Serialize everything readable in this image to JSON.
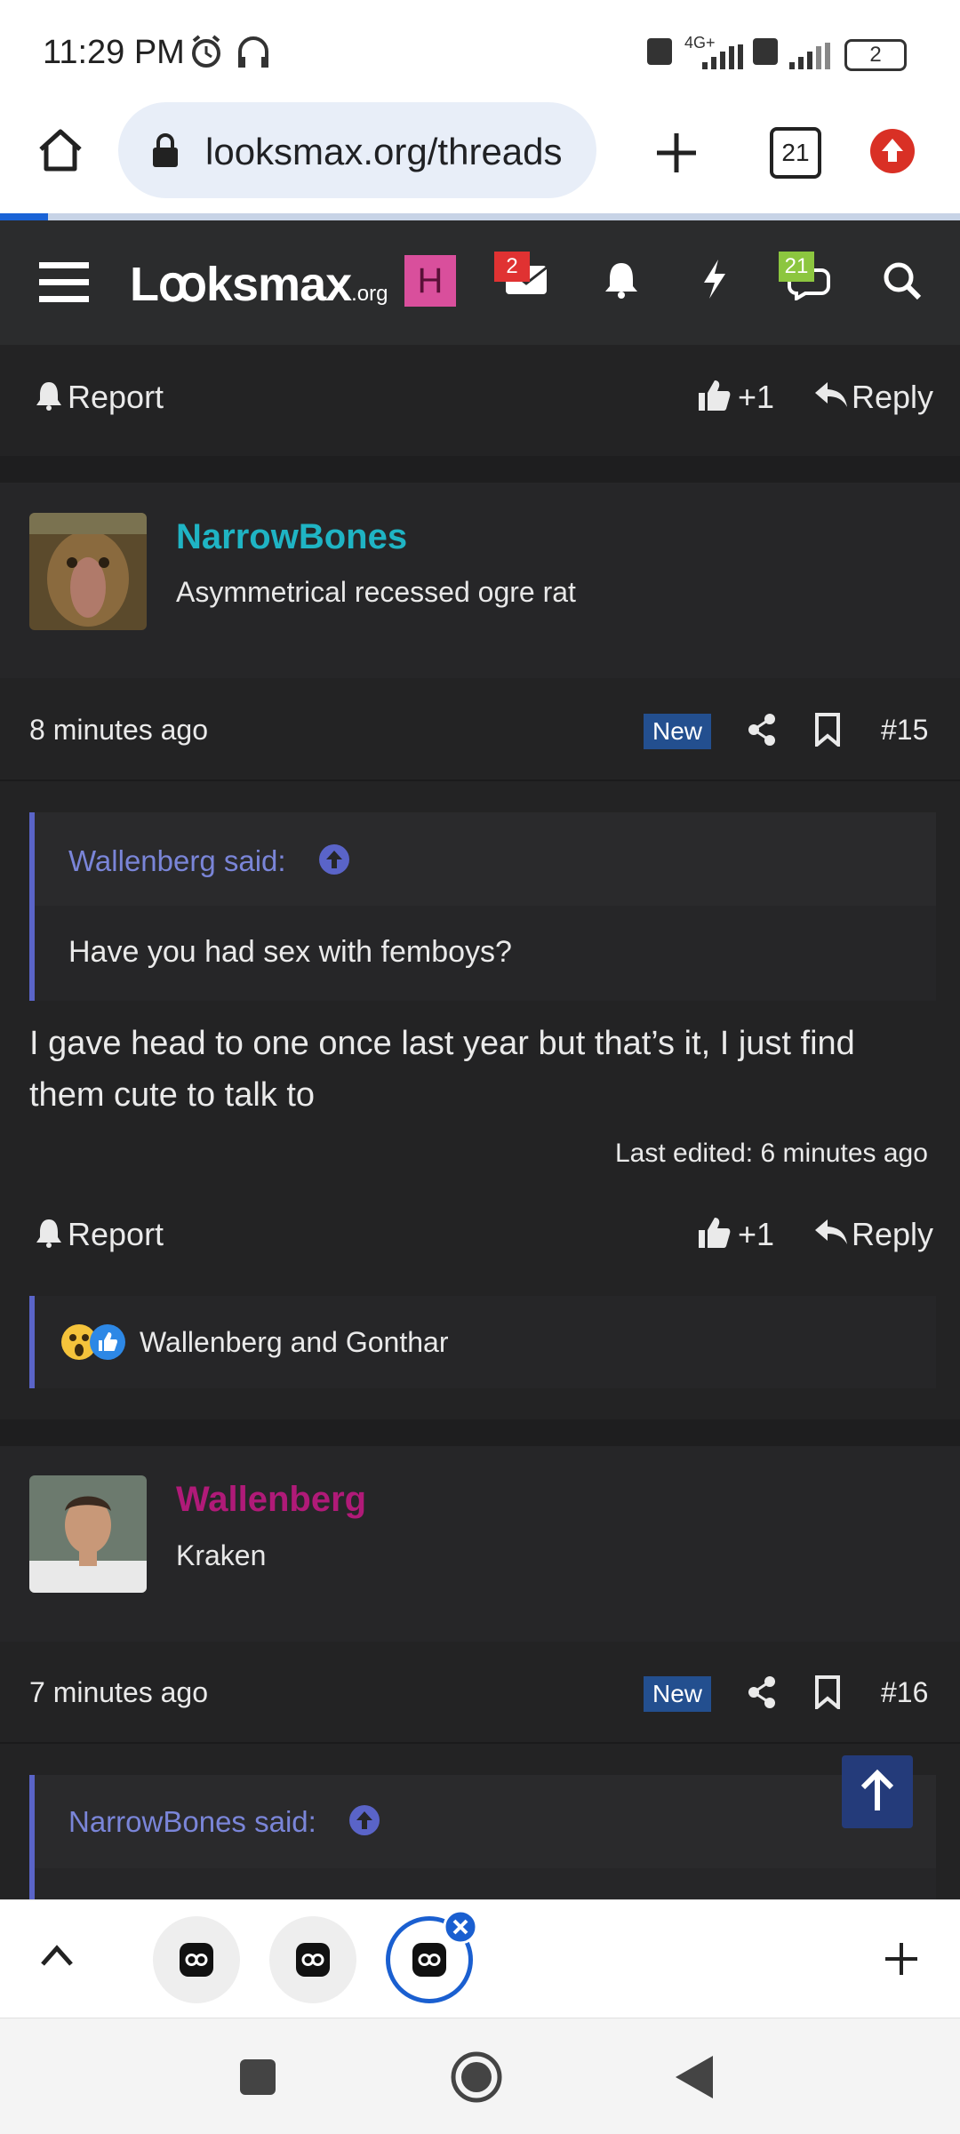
{
  "status_bar": {
    "time": "11:29 PM",
    "network": "4G+",
    "battery": "2"
  },
  "browser": {
    "url": "looksmax.org/threads",
    "tab_count": "21"
  },
  "forum_header": {
    "logo_main": "Lꝏksmax",
    "logo_suffix": ".org",
    "user_initial": "H",
    "inbox_count": "2",
    "conversations_count": "21"
  },
  "actions": {
    "report": "Report",
    "like": "+1",
    "reply": "Reply"
  },
  "posts": [
    {
      "username": "NarrowBones",
      "user_title": "Asymmetrical recessed ogre rat",
      "time": "8 minutes ago",
      "new_label": "New",
      "number": "#15",
      "quote_author": "Wallenberg said:",
      "quote_text": "Have you had sex with femboys?",
      "body_line1": "I gave head to one once last year but that’s it, I just find",
      "body_line2": "them cute to talk to",
      "edited": "Last edited: 6 minutes ago",
      "reactions": "Wallenberg and Gonthar"
    },
    {
      "username": "Wallenberg",
      "user_title": "Kraken",
      "time": "7 minutes ago",
      "new_label": "New",
      "number": "#16",
      "quote_author": "NarrowBones said:"
    }
  ],
  "colors": {
    "username_1": "#1fb4c4",
    "username_2": "#b01a78",
    "accent": "#5a64c8",
    "new_badge": "#234f8f"
  }
}
